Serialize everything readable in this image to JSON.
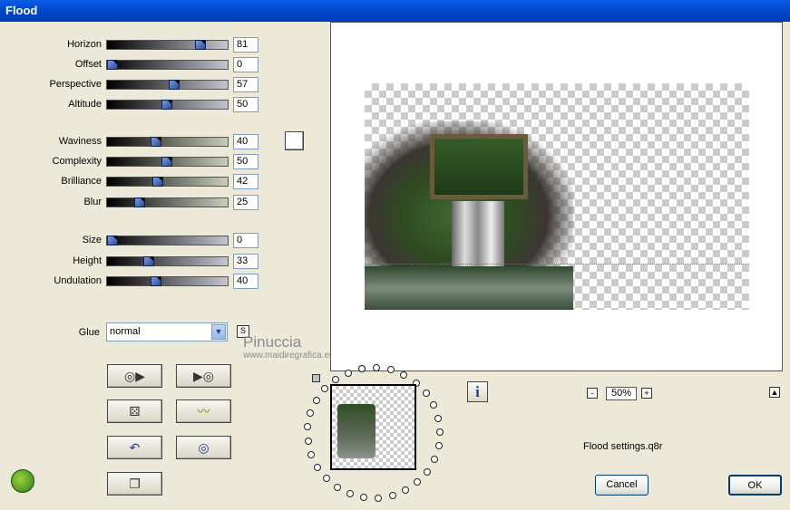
{
  "window": {
    "title": "Flood"
  },
  "params": [
    {
      "label": "Horizon",
      "value": "81",
      "level": 0.81
    },
    {
      "label": "Offset",
      "value": "0",
      "level": 0.0
    },
    {
      "label": "Perspective",
      "value": "57",
      "level": 0.57
    },
    {
      "label": "Altitude",
      "value": "50",
      "level": 0.5
    },
    {
      "label": "Waviness",
      "value": "40",
      "level": 0.4
    },
    {
      "label": "Complexity",
      "value": "50",
      "level": 0.5
    },
    {
      "label": "Brilliance",
      "value": "42",
      "level": 0.42
    },
    {
      "label": "Blur",
      "value": "25",
      "level": 0.25
    },
    {
      "label": "Size",
      "value": "0",
      "level": 0.0
    },
    {
      "label": "Height",
      "value": "33",
      "level": 0.33
    },
    {
      "label": "Undulation",
      "value": "40",
      "level": 0.4
    }
  ],
  "glue": {
    "label": "Glue",
    "value": "normal"
  },
  "watermark": {
    "line1": "Pinuccia",
    "line2": "www.maidiregrafica.eu"
  },
  "zoom": {
    "value": "50%",
    "minus": "-",
    "plus": "+"
  },
  "settings_file": "Flood settings.q8r",
  "buttons": {
    "cancel": "Cancel",
    "ok": "OK"
  },
  "colors": {
    "title_bar": "#0142c7",
    "window_bg": "#ece9d8"
  }
}
